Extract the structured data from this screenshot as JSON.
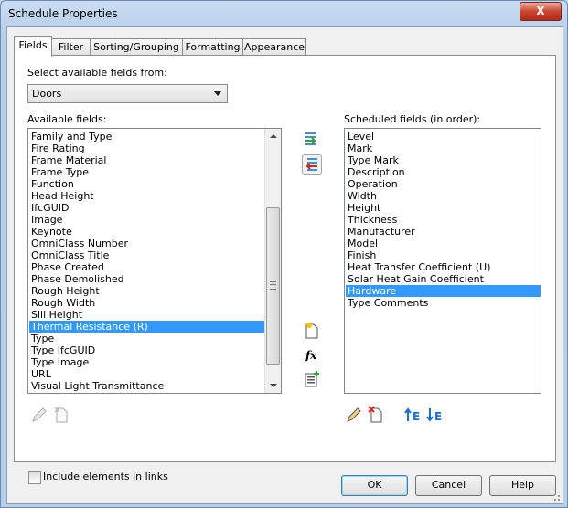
{
  "window": {
    "title": "Schedule Properties",
    "close_label": "X"
  },
  "tabs": [
    {
      "label": "Fields"
    },
    {
      "label": "Filter"
    },
    {
      "label": "Sorting/Grouping"
    },
    {
      "label": "Formatting"
    },
    {
      "label": "Appearance"
    }
  ],
  "fields_tab": {
    "select_from_label": "Select available fields from:",
    "category_value": "Doors",
    "available_label": "Available fields:",
    "scheduled_label": "Scheduled fields (in order):",
    "available_fields": [
      "Family and Type",
      "Fire Rating",
      "Frame Material",
      "Frame Type",
      "Function",
      "Head Height",
      "IfcGUID",
      "Image",
      "Keynote",
      "OmniClass Number",
      "OmniClass Title",
      "Phase Created",
      "Phase Demolished",
      "Rough Height",
      "Rough Width",
      "Sill Height",
      "Thermal Resistance (R)",
      "Type",
      "Type IfcGUID",
      "Type Image",
      "URL",
      "Visual Light Transmittance"
    ],
    "available_selected": "Thermal Resistance (R)",
    "scheduled_fields": [
      "Level",
      "Mark",
      "Type Mark",
      "Description",
      "Operation",
      "Width",
      "Height",
      "Thickness",
      "Manufacturer",
      "Model",
      "Finish",
      "Heat Transfer Coefficient (U)",
      "Solar Heat Gain Coefficient",
      "Hardware",
      "Type Comments"
    ],
    "scheduled_selected": "Hardware",
    "include_links_label": "Include elements in links",
    "include_links_checked": false
  },
  "buttons": {
    "ok": "OK",
    "cancel": "Cancel",
    "help": "Help"
  },
  "icons": {
    "add": "add-parameter-icon",
    "remove": "remove-parameter-icon",
    "new_param": "new-parameter-icon",
    "fx": "calculated-value-icon",
    "combine": "combine-parameters-icon",
    "edit": "edit-pencil-icon",
    "delete": "delete-parameter-icon",
    "move_up": "move-up-icon",
    "move_down": "move-down-icon"
  },
  "colors": {
    "selection": "#3399ff",
    "accent_blue": "#1f6fc7",
    "delete_red": "#d0281a"
  }
}
